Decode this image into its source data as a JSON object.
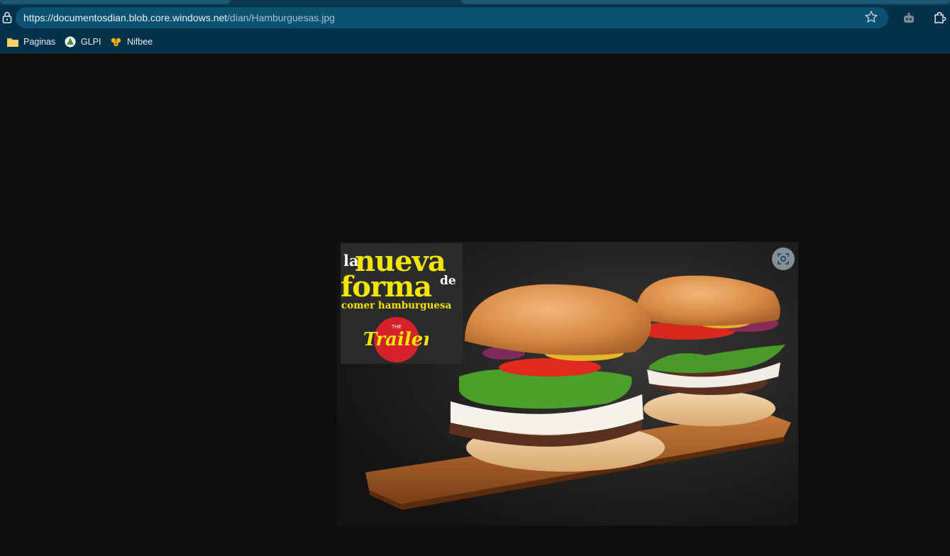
{
  "browser": {
    "address_bar": {
      "url_host": "https://documentosdian.blob.core.windows.net",
      "url_path": "/dian/Hamburguesas.jpg"
    },
    "toolbar_icons": [
      "lock-icon",
      "star-icon",
      "copilot-icon",
      "extensions-icon"
    ]
  },
  "bookmarks": [
    {
      "label": "Paginas",
      "icon": "folder-icon"
    },
    {
      "label": "GLPI",
      "icon": "glpi-icon"
    },
    {
      "label": "Nifbee",
      "icon": "nifbee-icon"
    }
  ],
  "image": {
    "promo_la": "la",
    "promo_nueva": "nueva",
    "promo_forma": "forma",
    "promo_de": "de",
    "promo_comer": "comer hamburguesa",
    "logo_the": "THE",
    "logo_name": "Trailer",
    "colors": {
      "promo_yellow": "#f3e600",
      "logo_red": "#d6202a",
      "background": "#0e0e0e"
    }
  }
}
